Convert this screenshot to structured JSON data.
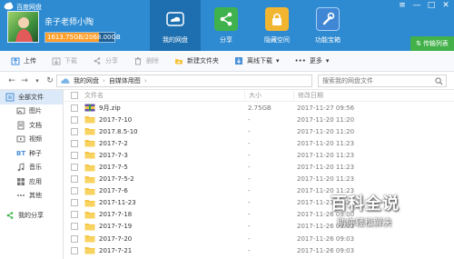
{
  "app": {
    "title": "百度网盘",
    "window_controls": [
      "≡",
      "—",
      "□",
      "✕"
    ]
  },
  "user": {
    "name": "亲子老师小陶",
    "quota_text": "1613.75GB/2068.00GB",
    "quota_used_fraction": 0.78
  },
  "main_tabs": [
    {
      "label": "我的网盘",
      "icon": "cloud-icon",
      "active": true
    },
    {
      "label": "分享",
      "icon": "share-icon",
      "active": false
    },
    {
      "label": "隐藏空间",
      "icon": "lock-icon",
      "active": false
    },
    {
      "label": "功能宝箱",
      "icon": "wrench-icon",
      "active": false
    }
  ],
  "upgrade": {
    "label": "传输列表"
  },
  "toolbar": {
    "upload": "上传",
    "download": "下载",
    "share": "分享",
    "delete": "删除",
    "new_folder": "新建文件夹",
    "offline_download": "离线下载",
    "more": "更多"
  },
  "address": {
    "root": "我的网盘",
    "folder": "自媒体用图",
    "search_placeholder": "搜索我的网盘文件"
  },
  "sidebar": {
    "all_files": "全部文件",
    "categories": [
      "图片",
      "文档",
      "视频",
      "种子",
      "音乐",
      "应用",
      "其他"
    ],
    "my_share": "我的分享"
  },
  "columns": {
    "name": "文件名",
    "size": "大小",
    "date": "修改日期"
  },
  "files": [
    {
      "name": "9月.zip",
      "size": "2.75GB",
      "date": "2017-11-27 09:56",
      "type": "zip"
    },
    {
      "name": "2017-7-10",
      "size": "-",
      "date": "2017-11-20 11:20",
      "type": "folder"
    },
    {
      "name": "2017.8.5-10",
      "size": "-",
      "date": "2017-11-20 11:20",
      "type": "folder"
    },
    {
      "name": "2017-7-2",
      "size": "-",
      "date": "2017-11-20 11:23",
      "type": "folder"
    },
    {
      "name": "2017-7-3",
      "size": "-",
      "date": "2017-11-20 11:23",
      "type": "folder"
    },
    {
      "name": "2017-7-5",
      "size": "-",
      "date": "2017-11-20 11:23",
      "type": "folder"
    },
    {
      "name": "2017-7-5-2",
      "size": "-",
      "date": "2017-11-20 11:23",
      "type": "folder"
    },
    {
      "name": "2017-7-6",
      "size": "-",
      "date": "2017-11-20 11:23",
      "type": "folder"
    },
    {
      "name": "2017-11-23",
      "size": "-",
      "date": "2017-11-23 11:28",
      "type": "folder"
    },
    {
      "name": "2017-7-18",
      "size": "-",
      "date": "2017-11-26 09:00",
      "type": "folder"
    },
    {
      "name": "2017-7-19",
      "size": "-",
      "date": "2017-11-26 09:03",
      "type": "folder"
    },
    {
      "name": "2017-7-20",
      "size": "-",
      "date": "2017-11-26 09:03",
      "type": "folder"
    },
    {
      "name": "2017-7-21",
      "size": "-",
      "date": "2017-11-26 09:03",
      "type": "folder"
    }
  ],
  "watermark": {
    "title": "百科全说",
    "subtitle": "助你轻松解决"
  },
  "colors": {
    "header": "#2e8bd1",
    "active_tab": "#1d6fb0",
    "quota": "#ff9e2a",
    "upgrade": "#43b14a",
    "folder": "#f5c443"
  }
}
